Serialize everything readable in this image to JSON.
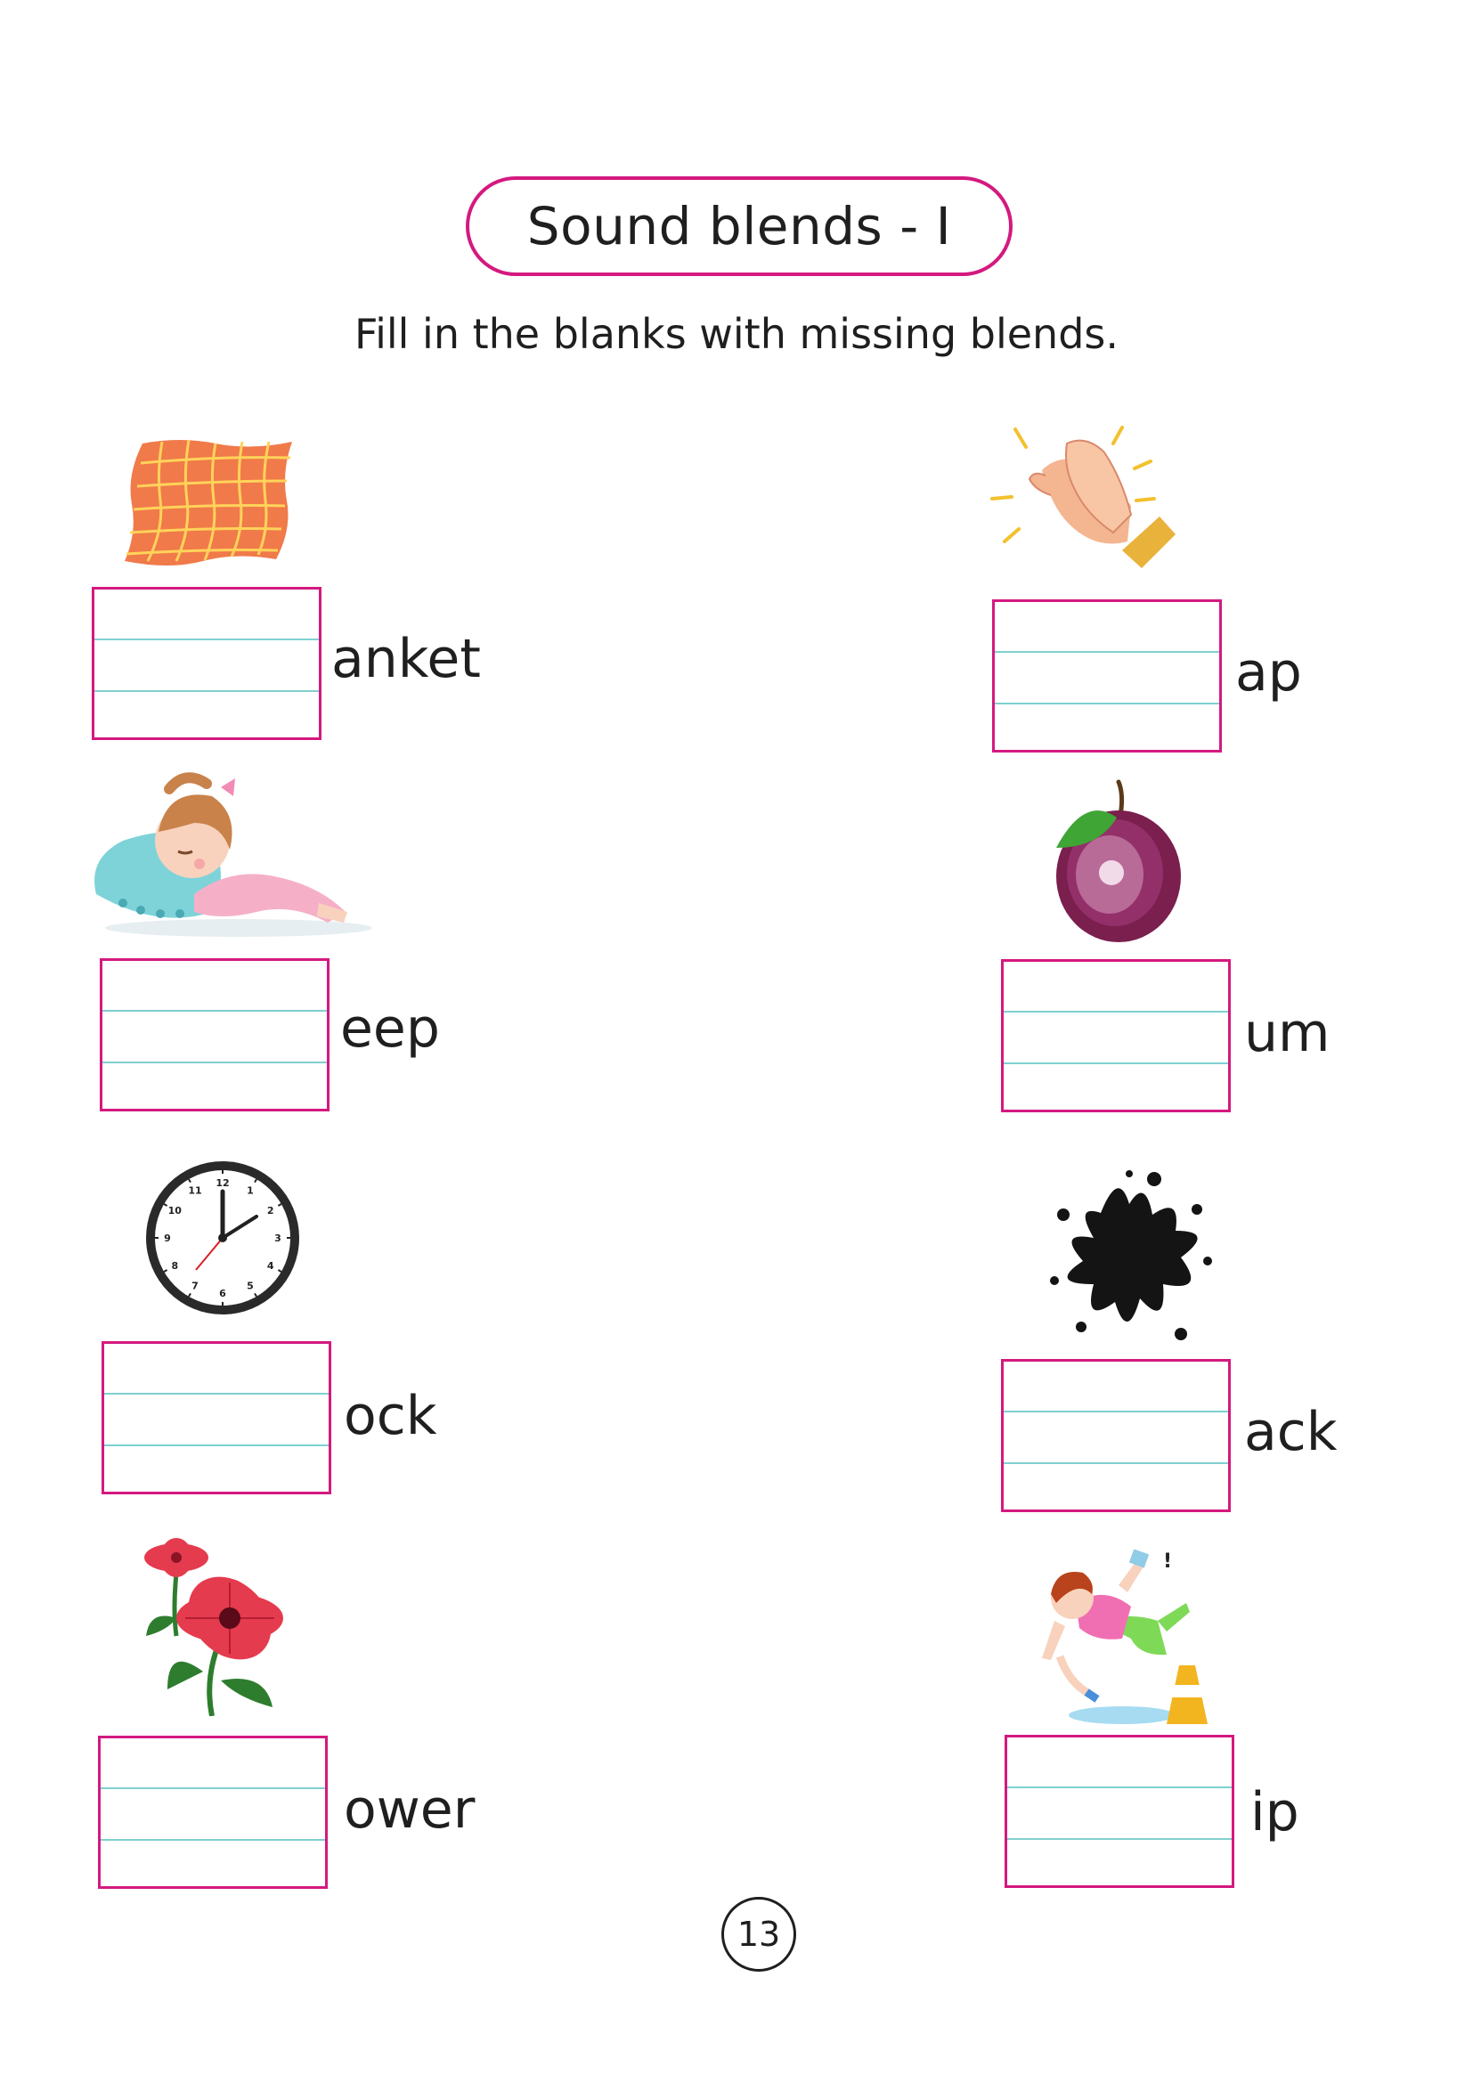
{
  "title": "Sound blends - I",
  "instructions": "Fill in the blanks with missing blends.",
  "page_number": "13",
  "items": [
    {
      "word": "anket",
      "picture": "blanket-icon"
    },
    {
      "word": "ap",
      "picture": "clapping-hands-icon"
    },
    {
      "word": "eep",
      "picture": "sleeping-girl-icon"
    },
    {
      "word": "um",
      "picture": "plum-icon"
    },
    {
      "word": "ock",
      "picture": "clock-icon"
    },
    {
      "word": "ack",
      "picture": "ink-splat-icon"
    },
    {
      "word": "ower",
      "picture": "flower-icon"
    },
    {
      "word": "ip",
      "picture": "slipping-girl-icon"
    }
  ],
  "clock_numerals": [
    "12",
    "1",
    "2",
    "3",
    "4",
    "5",
    "6",
    "7",
    "8",
    "9",
    "10",
    "11"
  ],
  "colors": {
    "accent": "#d4197f",
    "guide_line": "#7fd0cf",
    "text": "#1f1f1f"
  }
}
